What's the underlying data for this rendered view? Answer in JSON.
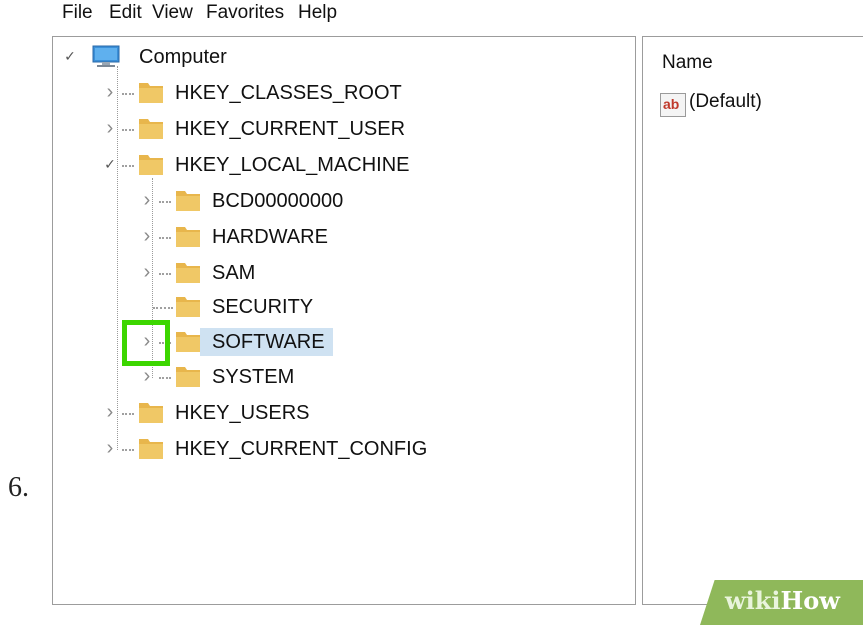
{
  "step": {
    "number": "6."
  },
  "menubar": {
    "items": [
      "File",
      "Edit",
      "View",
      "Favorites",
      "Help"
    ]
  },
  "tree": {
    "root": {
      "label": "Computer",
      "icon": "computer-icon",
      "expanded": true
    },
    "hives": [
      {
        "label": "HKEY_CLASSES_ROOT",
        "expanded": false
      },
      {
        "label": "HKEY_CURRENT_USER",
        "expanded": false
      },
      {
        "label": "HKEY_LOCAL_MACHINE",
        "expanded": true
      },
      {
        "label": "HKEY_USERS",
        "expanded": false
      },
      {
        "label": "HKEY_CURRENT_CONFIG",
        "expanded": false
      }
    ],
    "local_machine_children": [
      {
        "label": "BCD00000000",
        "has_children": true,
        "selected": false
      },
      {
        "label": "HARDWARE",
        "has_children": true,
        "selected": false
      },
      {
        "label": "SAM",
        "has_children": true,
        "selected": false
      },
      {
        "label": "SECURITY",
        "has_children": false,
        "selected": false
      },
      {
        "label": "SOFTWARE",
        "has_children": true,
        "selected": true
      },
      {
        "label": "SYSTEM",
        "has_children": true,
        "selected": false
      }
    ]
  },
  "values_pane": {
    "column_header": "Name",
    "rows": [
      {
        "icon": "string-value-icon",
        "icon_text": "ab",
        "name": "(Default)"
      }
    ]
  },
  "highlight": {
    "target": "SOFTWARE expand arrow",
    "color": "#3cd600"
  },
  "watermark": {
    "part1": "wiki",
    "part2": "How"
  },
  "colors": {
    "selection": "#cfe2f2",
    "folder": "#e8b64c",
    "highlight": "#3cd600"
  }
}
